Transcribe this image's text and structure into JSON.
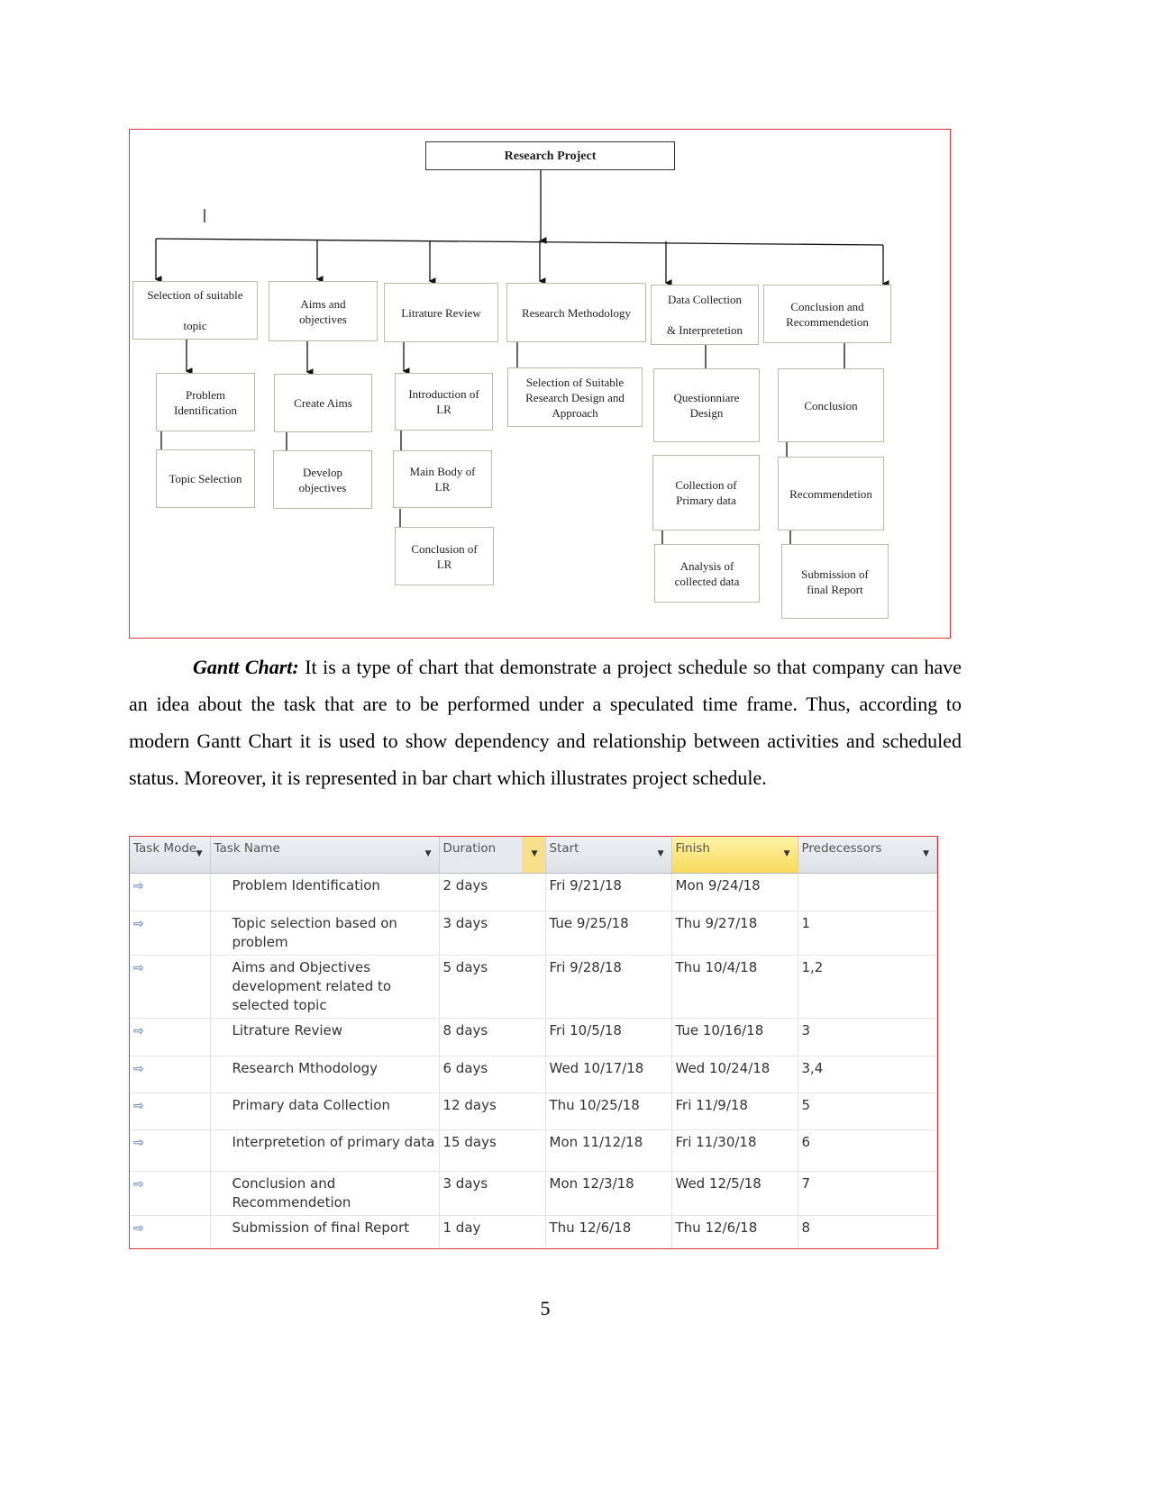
{
  "diagram": {
    "root": "Research Project",
    "level1": [
      "Selection of suitable\n\ntopic",
      "Aims and\nobjectives",
      "Litrature Review",
      "Research Methodology",
      "Data Collection\n\n&  Interpretetion",
      "Conclusion and\nRecommendetion"
    ],
    "level2": [
      "Problem\nIdentification",
      "Create Aims",
      "Introduction of\nLR",
      "Selection of Suitable\nResearch Design and\nApproach",
      "Questionniare\nDesign",
      "Conclusion"
    ],
    "level3": [
      "Topic Selection",
      "Develop\nobjectives",
      "Main Body of\nLR",
      "Collection of\nPrimary data",
      "Recommendetion"
    ],
    "level4": [
      "Conclusion of\nLR",
      "Analysis of\ncollected data",
      "Submission of\nfinal Report"
    ]
  },
  "paragraph": {
    "lead": "Gantt Chart:",
    "text": " It is a type of chart that demonstrate a project schedule so that company can have an idea about the task that are to be performed under a speculated time frame. Thus, according to modern Gantt Chart it is used to show dependency and relationship between activities and scheduled status. Moreover, it is represented in bar chart which illustrates project schedule."
  },
  "gantt": {
    "headers": [
      "Task Mode",
      "Task Name",
      "Duration",
      "Start",
      "Finish",
      "Predecessors"
    ],
    "mode_icon": "auto-scheduled-task-icon",
    "rows": [
      [
        "Problem Identification",
        "2 days",
        "Fri 9/21/18",
        "Mon 9/24/18",
        ""
      ],
      [
        "Topic selection based on problem",
        "3 days",
        "Tue 9/25/18",
        "Thu 9/27/18",
        "1"
      ],
      [
        "Aims and Objectives development related to selected topic",
        "5 days",
        "Fri 9/28/18",
        "Thu 10/4/18",
        "1,2"
      ],
      [
        "Litrature Review",
        "8 days",
        "Fri 10/5/18",
        "Tue 10/16/18",
        "3"
      ],
      [
        "Research Mthodology",
        "6 days",
        "Wed 10/17/18",
        "Wed 10/24/18",
        "3,4"
      ],
      [
        "Primary data Collection",
        "12 days",
        "Thu 10/25/18",
        "Fri 11/9/18",
        "5"
      ],
      [
        "Interpretetion of primary data",
        "15 days",
        "Mon 11/12/18",
        "Fri 11/30/18",
        "6"
      ],
      [
        "Conclusion and Recommendetion",
        "3 days",
        "Mon 12/3/18",
        "Wed 12/5/18",
        "7"
      ],
      [
        "Submission of final Report",
        "1 day",
        "Thu 12/6/18",
        "Thu 12/6/18",
        "8"
      ]
    ]
  },
  "page_number": "5"
}
